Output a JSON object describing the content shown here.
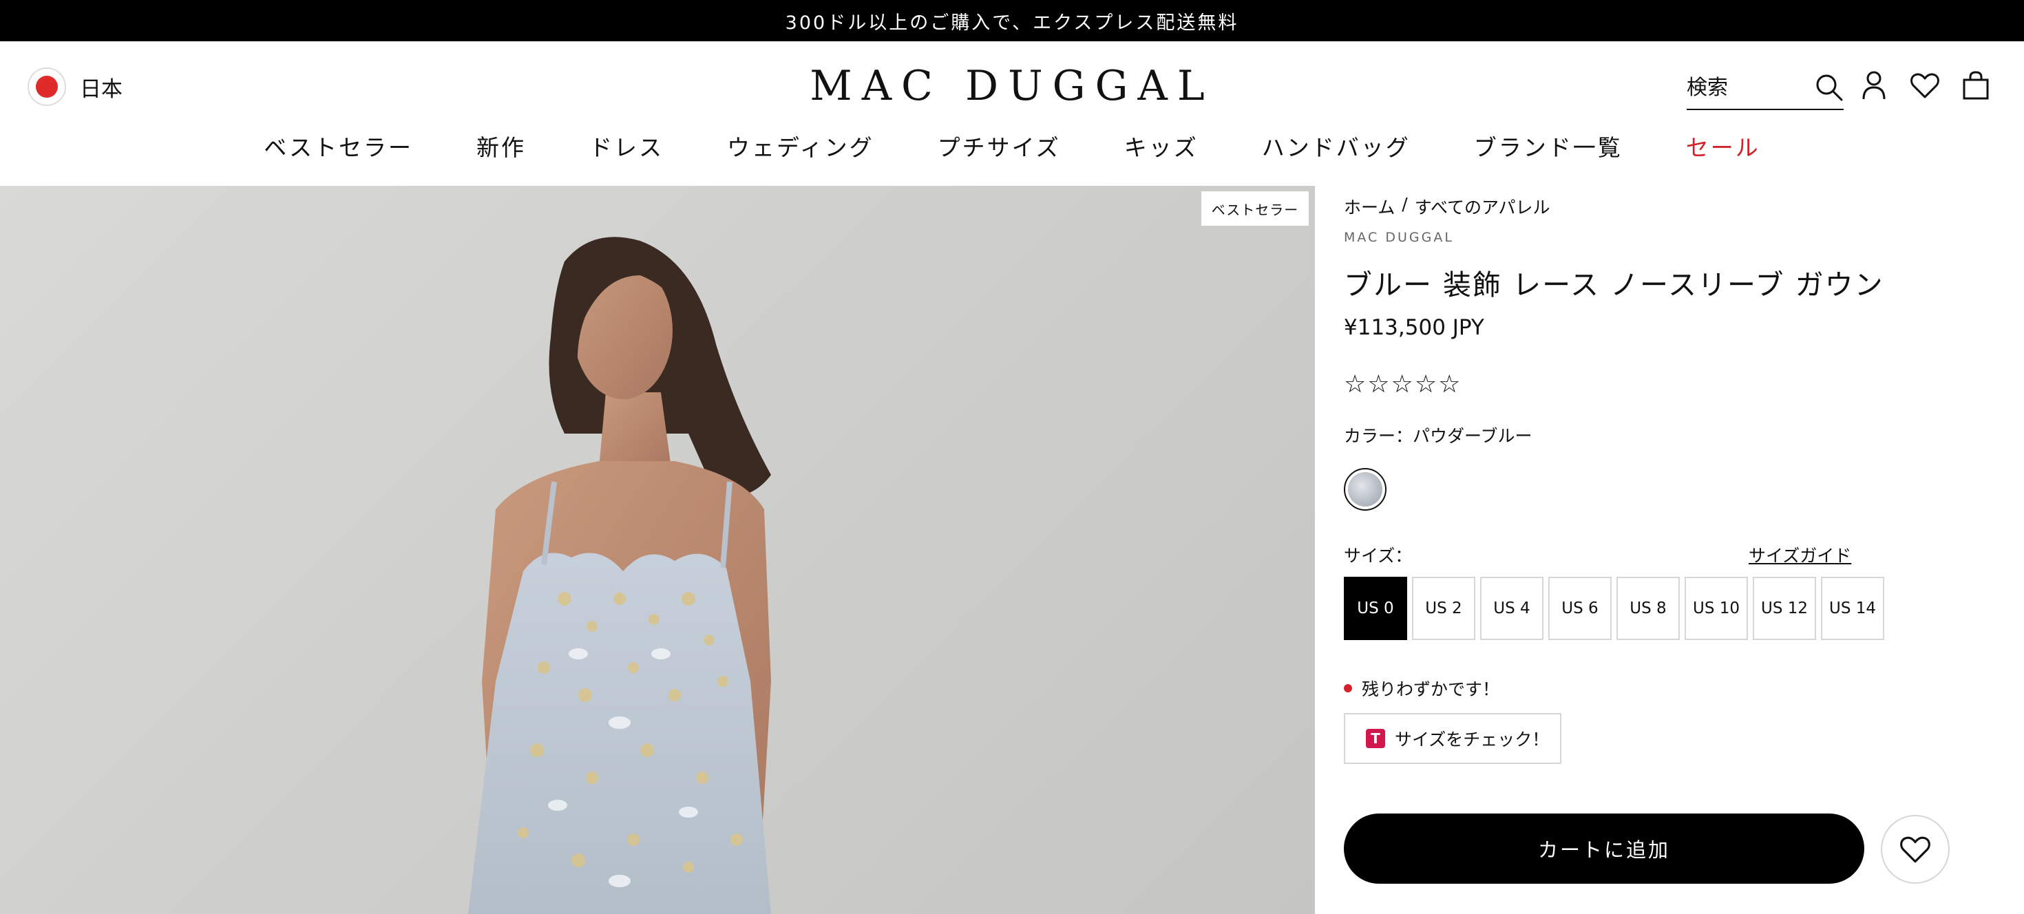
{
  "announcement": {
    "text": "300ドル以上のご購入で、エクスプレス配送無料"
  },
  "header": {
    "locale_label": "日本",
    "logo_text": "MAC DUGGAL",
    "search_placeholder": "検索"
  },
  "nav": {
    "items": [
      {
        "label": "ベストセラー"
      },
      {
        "label": "新作"
      },
      {
        "label": "ドレス"
      },
      {
        "label": "ウェディング"
      },
      {
        "label": "プチサイズ"
      },
      {
        "label": "キッズ"
      },
      {
        "label": "ハンドバッグ"
      },
      {
        "label": "ブランド一覧"
      },
      {
        "label": "セール"
      }
    ]
  },
  "product_image": {
    "badge": "ベストセラー"
  },
  "product": {
    "breadcrumb": {
      "home": "ホーム",
      "separator": "/",
      "category": "すべてのアパレル"
    },
    "brand": "MAC DUGGAL",
    "title": "ブルー 装飾 レース ノースリーブ ガウン",
    "price": "¥113,500 JPY",
    "rating_stars": "☆☆☆☆☆",
    "color_label": "カラー：パウダーブルー",
    "size_label": "サイズ：",
    "size_guide_label": "サイズガイド",
    "sizes": [
      {
        "label": "US 0"
      },
      {
        "label": "US 2"
      },
      {
        "label": "US 4"
      },
      {
        "label": "US 6"
      },
      {
        "label": "US 8"
      },
      {
        "label": "US 10"
      },
      {
        "label": "US 12"
      },
      {
        "label": "US 14"
      }
    ],
    "selected_size": "US 0",
    "stock_message": "残りわずかです！",
    "fit_check_label": "サイズをチェック！",
    "fit_check_icon_letter": "T",
    "add_to_cart_label": "カートに追加"
  },
  "colors": {
    "sale_red": "#d2222b",
    "stock_dot": "#d2222b",
    "primary_button": "#000000",
    "fit_icon": "#d2174f"
  }
}
